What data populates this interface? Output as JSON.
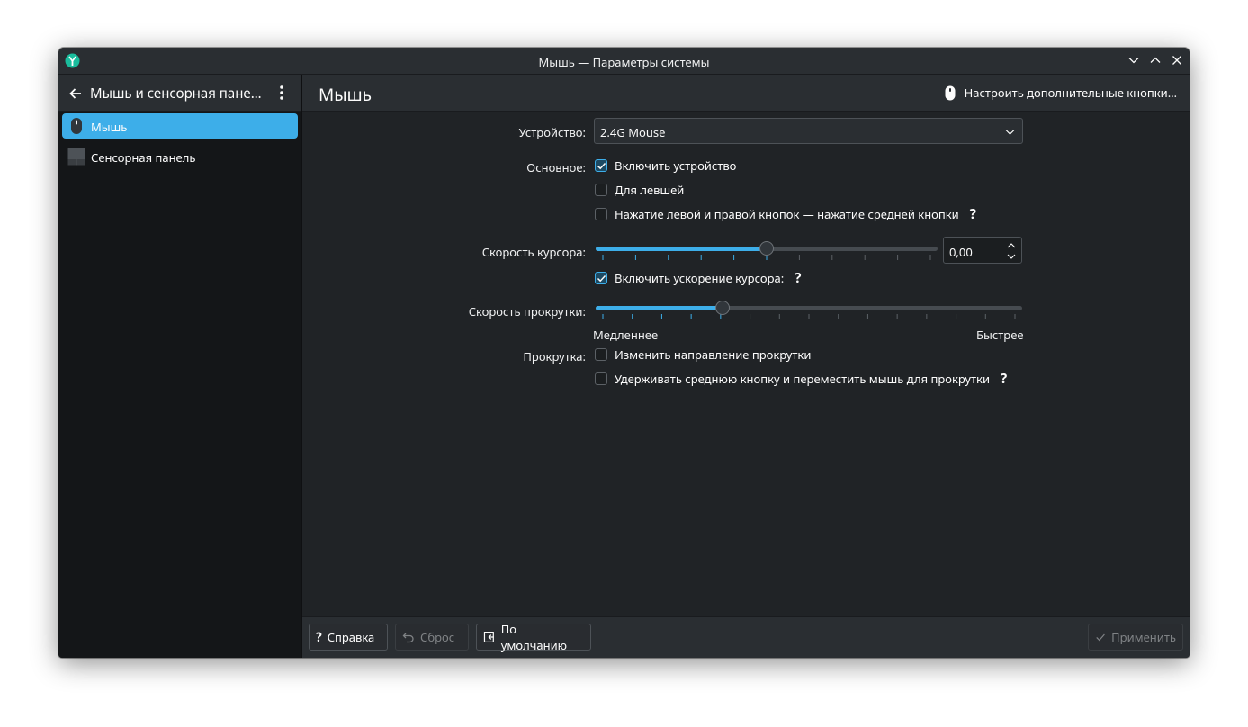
{
  "window": {
    "title": "Мышь — Параметры системы"
  },
  "sidebar": {
    "header_title": "Мышь и сенсорная пане…",
    "items": [
      {
        "label": "Мышь",
        "icon": "mouse-icon",
        "active": true
      },
      {
        "label": "Сенсорная панель",
        "icon": "touchpad-icon",
        "active": false
      }
    ]
  },
  "main": {
    "title": "Мышь",
    "extra_buttons_label": "Настроить дополнительные кнопки…"
  },
  "form": {
    "device_label": "Устройство:",
    "device_value": "2.4G Mouse",
    "general_label": "Основное:",
    "enable_device": {
      "label": "Включить устройство",
      "checked": true
    },
    "left_handed": {
      "label": "Для левшей",
      "checked": false
    },
    "middle_emulation": {
      "label": "Нажатие левой и правой кнопок — нажатие средней кнопки",
      "checked": false
    },
    "pointer_speed_label": "Скорость курсора:",
    "pointer_speed_value": "0,00",
    "pointer_speed_fraction": 0.5,
    "pointer_accel": {
      "label": "Включить ускорение курсора:",
      "checked": true
    },
    "scroll_speed_label": "Скорость прокрутки:",
    "scroll_speed_fraction": 0.29,
    "slower_label": "Медленнее",
    "faster_label": "Быстрее",
    "scrolling_label": "Прокрутка:",
    "invert_scroll": {
      "label": "Изменить направление прокрутки",
      "checked": false
    },
    "middle_scroll": {
      "label": "Удерживать среднюю кнопку и переместить мышь для прокрутки",
      "checked": false
    },
    "help_glyph": "?"
  },
  "footer": {
    "help_label": "Справка",
    "reset_label": "Сброс",
    "defaults_label": "По умолчанию",
    "apply_label": "Применить"
  },
  "colors": {
    "accent": "#3daee9",
    "background": "#202326",
    "header": "#2a2e32"
  }
}
